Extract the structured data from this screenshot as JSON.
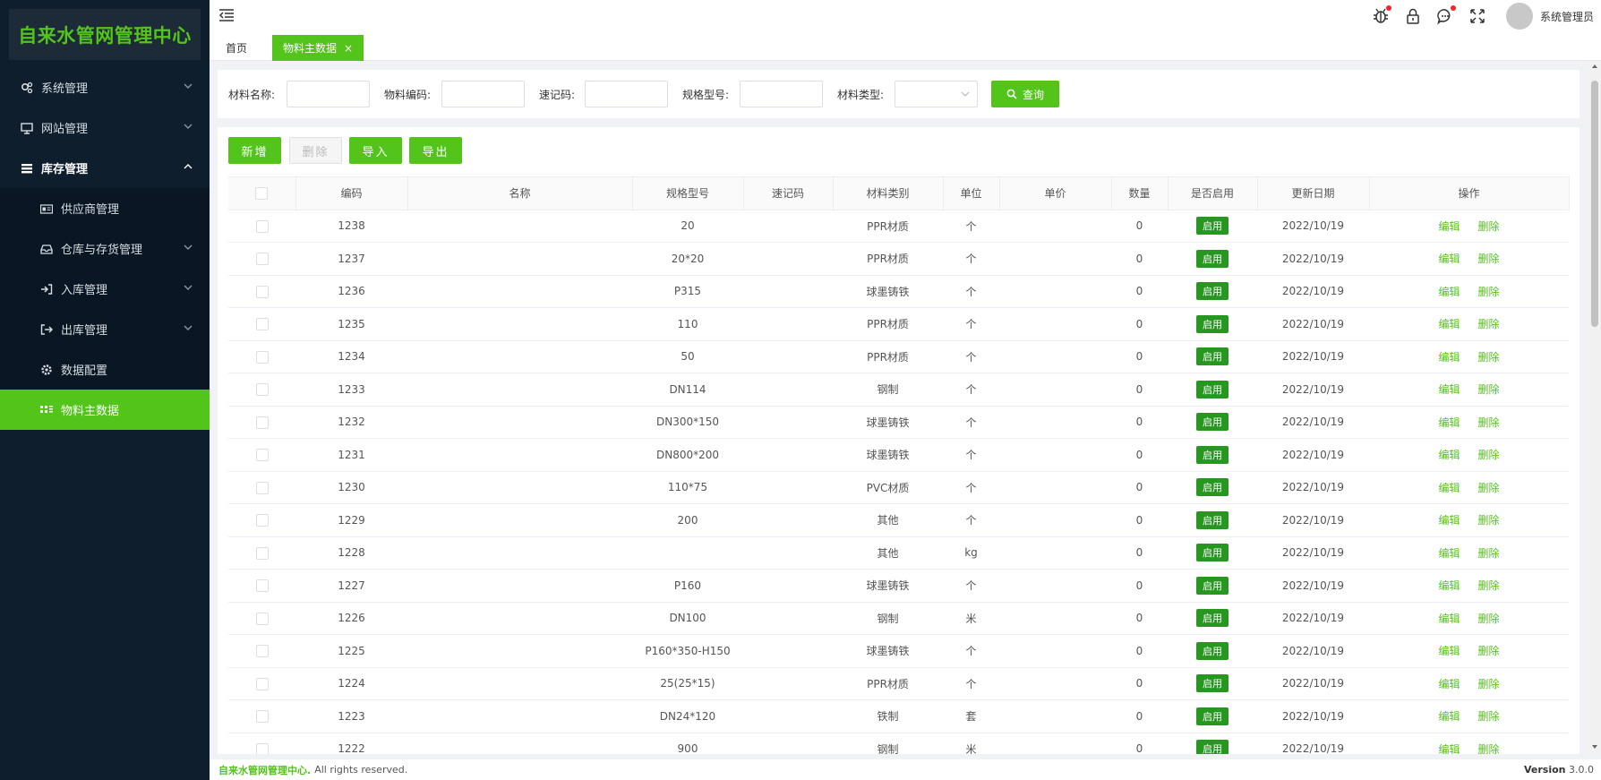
{
  "app": {
    "title": "自来水管网管理中心"
  },
  "sidebar": {
    "items": [
      {
        "label": "系统管理",
        "icon": "gears-icon"
      },
      {
        "label": "网站管理",
        "icon": "monitor-icon"
      },
      {
        "label": "库存管理",
        "icon": "list-icon"
      },
      {
        "label": "供应商管理",
        "icon": "id-card-icon"
      },
      {
        "label": "仓库与存货管理",
        "icon": "inbox-icon"
      },
      {
        "label": "入库管理",
        "icon": "sign-in-icon"
      },
      {
        "label": "出库管理",
        "icon": "sign-out-icon"
      },
      {
        "label": "数据配置",
        "icon": "gear-icon"
      },
      {
        "label": "物料主数据",
        "icon": "grid-icon"
      }
    ]
  },
  "header": {
    "user_name": "系统管理员"
  },
  "tabs": {
    "home": "首页",
    "current": "物料主数据",
    "close": "×"
  },
  "search": {
    "f1_label": "材料名称:",
    "f2_label": "物料编码:",
    "f3_label": "速记码:",
    "f4_label": "规格型号:",
    "f5_label": "材料类型:",
    "query_label": "查询"
  },
  "toolbar": {
    "add": "新增",
    "delete": "删除",
    "import": "导入",
    "export": "导出"
  },
  "table": {
    "columns": [
      "编码",
      "名称",
      "规格型号",
      "速记码",
      "材料类别",
      "单位",
      "单价",
      "数量",
      "是否启用",
      "更新日期",
      "操作"
    ],
    "enabled_label": "启用",
    "edit_label": "编辑",
    "delete_label": "删除",
    "rows": [
      {
        "code": "1238",
        "spec": "20",
        "category": "PPR材质",
        "unit": "个",
        "qty": "0",
        "date": "2022/10/19"
      },
      {
        "code": "1237",
        "spec": "20*20",
        "category": "PPR材质",
        "unit": "个",
        "qty": "0",
        "date": "2022/10/19"
      },
      {
        "code": "1236",
        "spec": "P315",
        "category": "球墨铸铁",
        "unit": "个",
        "qty": "0",
        "date": "2022/10/19"
      },
      {
        "code": "1235",
        "spec": "110",
        "category": "PPR材质",
        "unit": "个",
        "qty": "0",
        "date": "2022/10/19"
      },
      {
        "code": "1234",
        "spec": "50",
        "category": "PPR材质",
        "unit": "个",
        "qty": "0",
        "date": "2022/10/19"
      },
      {
        "code": "1233",
        "spec": "DN114",
        "category": "钢制",
        "unit": "个",
        "qty": "0",
        "date": "2022/10/19"
      },
      {
        "code": "1232",
        "spec": "DN300*150",
        "category": "球墨铸铁",
        "unit": "个",
        "qty": "0",
        "date": "2022/10/19"
      },
      {
        "code": "1231",
        "spec": "DN800*200",
        "category": "球墨铸铁",
        "unit": "个",
        "qty": "0",
        "date": "2022/10/19"
      },
      {
        "code": "1230",
        "spec": "110*75",
        "category": "PVC材质",
        "unit": "个",
        "qty": "0",
        "date": "2022/10/19"
      },
      {
        "code": "1229",
        "spec": "200",
        "category": "其他",
        "unit": "个",
        "qty": "0",
        "date": "2022/10/19"
      },
      {
        "code": "1228",
        "spec": "",
        "category": "其他",
        "unit": "kg",
        "qty": "0",
        "date": "2022/10/19"
      },
      {
        "code": "1227",
        "spec": "P160",
        "category": "球墨铸铁",
        "unit": "个",
        "qty": "0",
        "date": "2022/10/19"
      },
      {
        "code": "1226",
        "spec": "DN100",
        "category": "钢制",
        "unit": "米",
        "qty": "0",
        "date": "2022/10/19"
      },
      {
        "code": "1225",
        "spec": "P160*350-H150",
        "category": "球墨铸铁",
        "unit": "个",
        "qty": "0",
        "date": "2022/10/19"
      },
      {
        "code": "1224",
        "spec": "25(25*15)",
        "category": "PPR材质",
        "unit": "个",
        "qty": "0",
        "date": "2022/10/19"
      },
      {
        "code": "1223",
        "spec": "DN24*120",
        "category": "铁制",
        "unit": "套",
        "qty": "0",
        "date": "2022/10/19"
      },
      {
        "code": "1222",
        "spec": "900",
        "category": "钢制",
        "unit": "米",
        "qty": "0",
        "date": "2022/10/19"
      }
    ]
  },
  "footer": {
    "brand": "自来水管网管理中心.",
    "rights": "All rights reserved.",
    "version_label": "Version",
    "version": "3.0.0"
  },
  "colors": {
    "accent": "#52c41a",
    "sidebar_bg": "#0f1e2d",
    "badge": "#289722"
  }
}
